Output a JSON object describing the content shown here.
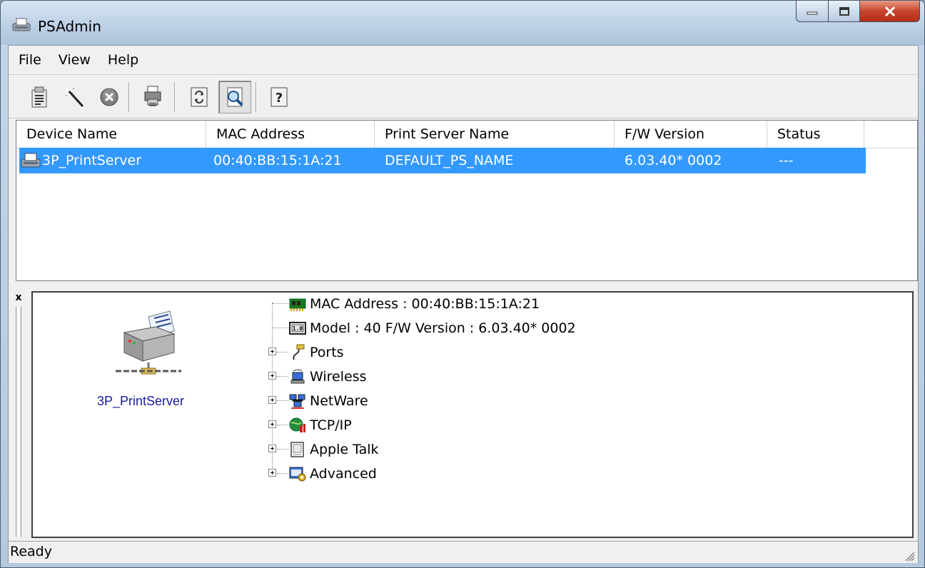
{
  "window": {
    "title": "PSAdmin"
  },
  "menu": [
    "File",
    "View",
    "Help"
  ],
  "toolbar": {
    "buttons": [
      "properties-icon",
      "wizard-wand-icon",
      "delete-icon",
      "printer-upgrade-icon",
      "refresh-icon",
      "search-icon",
      "help-icon"
    ],
    "pressed": "search-icon"
  },
  "list": {
    "columns": [
      "Device Name",
      "MAC Address",
      "Print Server Name",
      "F/W Version",
      "Status"
    ],
    "rows": [
      {
        "device_name": "3P_PrintServer",
        "mac": "00:40:BB:15:1A:21",
        "ps_name": "DEFAULT_PS_NAME",
        "fw": "6.03.40* 0002",
        "status": "---",
        "selected": true
      }
    ]
  },
  "details": {
    "close_glyph": "x",
    "device_label": "3P_PrintServer",
    "tree": [
      {
        "label": "MAC Address : 00:40:BB:15:1A:21",
        "icon": "network-card-icon",
        "expandable": false
      },
      {
        "label": "Model : 40   F/W Version : 6.03.40* 0002",
        "icon": "firmware-chip-icon",
        "expandable": false
      },
      {
        "label": "Ports",
        "icon": "port-cable-icon",
        "expandable": true
      },
      {
        "label": "Wireless",
        "icon": "wireless-computer-icon",
        "expandable": true
      },
      {
        "label": "NetWare",
        "icon": "netware-computers-icon",
        "expandable": true
      },
      {
        "label": "TCP/IP",
        "icon": "tcpip-globe-icon",
        "expandable": true
      },
      {
        "label": "Apple Talk",
        "icon": "apple-talk-icon",
        "expandable": true
      },
      {
        "label": "Advanced",
        "icon": "advanced-settings-icon",
        "expandable": true
      }
    ]
  },
  "status": {
    "text": "Ready"
  },
  "colors": {
    "selection": "#3399ff",
    "title_gradient_top": "#d7e5f3",
    "close_button": "#c9432a",
    "device_label": "#1a1aa0"
  }
}
